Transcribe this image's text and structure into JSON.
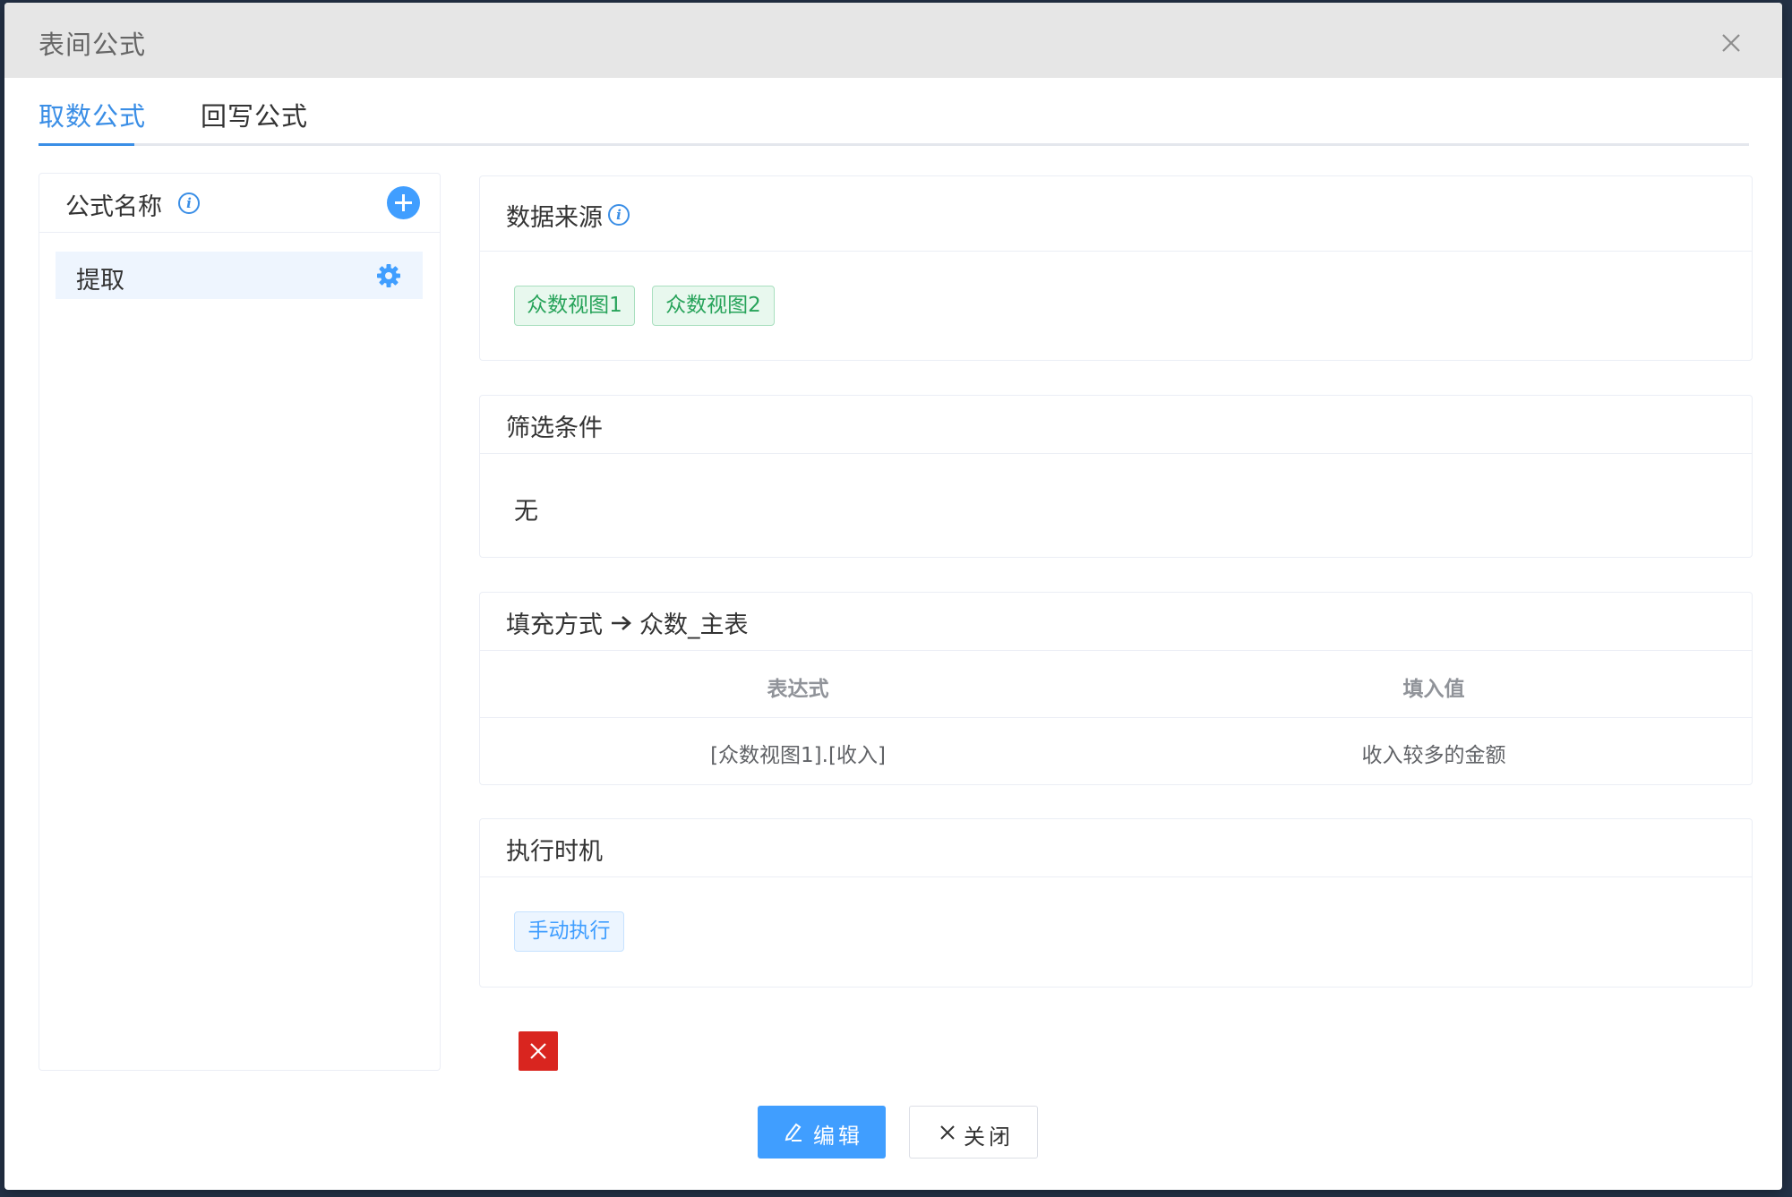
{
  "dialog": {
    "title": "表间公式"
  },
  "tabs": [
    {
      "label": "取数公式",
      "active": true
    },
    {
      "label": "回写公式",
      "active": false
    }
  ],
  "formula_list": {
    "title": "公式名称",
    "items": [
      {
        "label": "提取",
        "selected": true
      }
    ]
  },
  "data_source": {
    "title": "数据来源",
    "tags": [
      "众数视图1",
      "众数视图2"
    ]
  },
  "filter": {
    "title": "筛选条件",
    "value": "无"
  },
  "fill": {
    "title": "填充方式",
    "target": "众数_主表",
    "columns": [
      "表达式",
      "填入值"
    ],
    "rows": [
      [
        "[众数视图1].[收入]",
        "收入较多的金额"
      ]
    ]
  },
  "timing": {
    "title": "执行时机",
    "tag": "手动执行"
  },
  "footer": {
    "edit_label": "编辑",
    "close_label": "关闭"
  },
  "colors": {
    "accent": "#409eff",
    "tab_active": "#3a8ee6",
    "tag_green": "#27a35a",
    "danger": "#d9251f",
    "header_bg": "#e6e6e6"
  }
}
